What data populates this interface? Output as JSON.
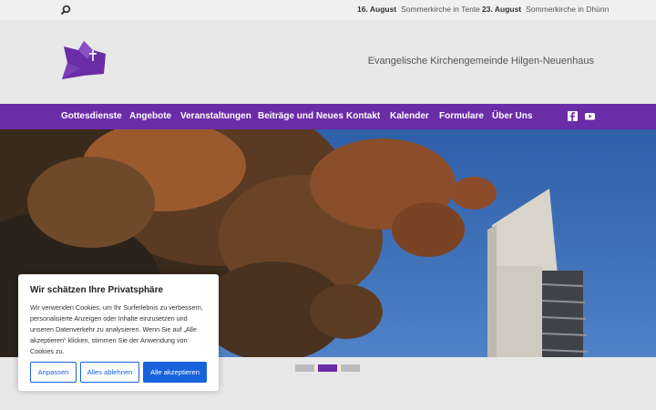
{
  "topbar": {
    "events": [
      {
        "date": "16. August",
        "title": "Sommerkirche in Tente"
      },
      {
        "date": "23. August",
        "title": "Sommerkirche in Dhünn"
      }
    ]
  },
  "header": {
    "site_title": "Evangelische Kirchengemeinde Hilgen-Neuenhaus"
  },
  "nav": {
    "items": [
      "Gottesdienste",
      "Angebote",
      "Veranstaltungen",
      "Beiträge und Neues",
      "Kontakt",
      "Kalender",
      "Formulare",
      "Über Uns"
    ]
  },
  "colors": {
    "brand": "#6a2ca7",
    "accent_button": "#1863dc"
  },
  "slider": {
    "count": 3,
    "active_index": 1
  },
  "cookie": {
    "title": "Wir schätzen Ihre Privatsphäre",
    "text": "Wir verwenden Cookies, um Ihr Surferlebnis zu verbessern, personalisierte Anzeigen oder Inhalte einzusetzen und unseren Datenverkehr zu analysieren. Wenn Sie auf „Alle akzeptieren“ klicken, stimmen Sie der Anwendung von Cookies zu.",
    "customize_label": "Anpassen",
    "reject_label": "Alles ablehnen",
    "accept_label": "Alle akzeptieren"
  }
}
